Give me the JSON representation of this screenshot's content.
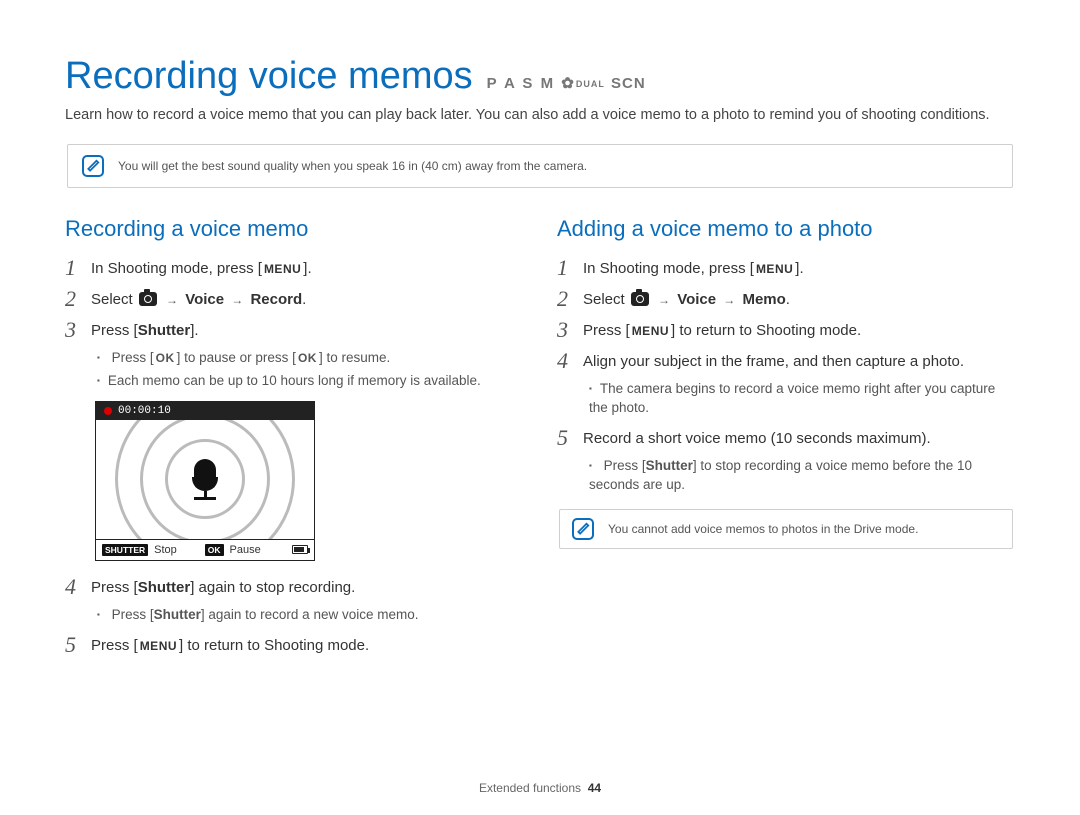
{
  "header": {
    "title": "Recording voice memos",
    "modes_pasm": "P A S M",
    "modes_dual": "DUAL",
    "modes_scn": "SCN"
  },
  "intro": "Learn how to record a voice memo that you can play back later. You can also add a voice memo to a photo to remind you of shooting conditions.",
  "note_top": "You will get the best sound quality when you speak 16 in (40 cm) away from the camera.",
  "left": {
    "title": "Recording a voice memo",
    "step1_a": "In Shooting mode, press [",
    "menu_btn": "MENU",
    "step1_b": "].",
    "step2_a": "Select ",
    "step2_voice": "Voice",
    "step2_record": "Record",
    "step2_b": ".",
    "step3_a": "Press [",
    "shutter_btn": "Shutter",
    "step3_b": "].",
    "bullet1_a": "Press [",
    "ok_btn": "OK",
    "bullet1_b": "] to pause or press [",
    "bullet1_c": "] to resume.",
    "bullet2": "Each memo can be up to 10 hours long if memory is available.",
    "shot_time": "00:00:10",
    "shot_stop": "Stop",
    "shot_pause": "Pause",
    "step4_a": "Press [",
    "step4_b": "] again to stop recording.",
    "bullet3_a": "Press [",
    "bullet3_b": "] again to record a new voice memo.",
    "step5_a": "Press [",
    "step5_b": "] to return to Shooting mode."
  },
  "right": {
    "title": "Adding a voice memo to a photo",
    "step1_a": "In Shooting mode, press [",
    "step1_b": "].",
    "step2_a": "Select ",
    "step2_voice": "Voice",
    "step2_memo": "Memo",
    "step2_b": ".",
    "step3_a": "Press [",
    "step3_b": "] to return to Shooting mode.",
    "step4": "Align your subject in the frame, and then capture a photo.",
    "bullet1": "The camera begins to record a voice memo right after you capture the photo.",
    "step5": "Record a short voice memo (10 seconds maximum).",
    "bullet2_a": "Press [",
    "bullet2_b": "] to stop recording a voice memo before the 10 seconds are up.",
    "note": "You cannot add voice memos to photos in the Drive mode."
  },
  "footer": {
    "section": "Extended functions",
    "page": "44"
  }
}
